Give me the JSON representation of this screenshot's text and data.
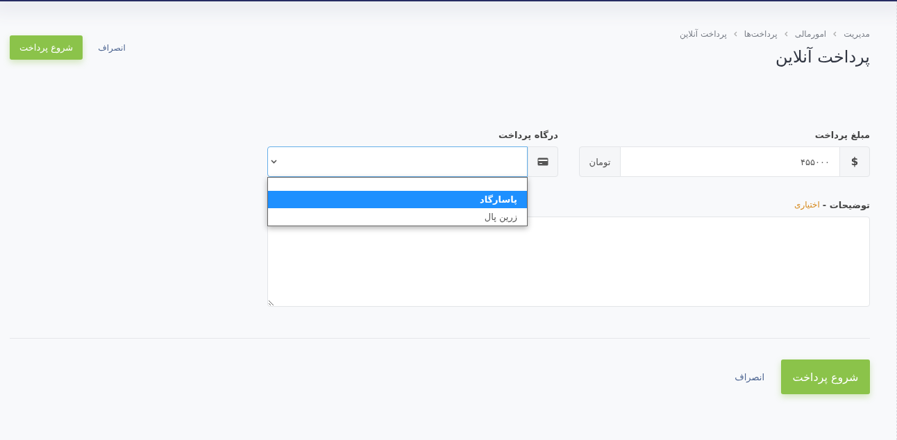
{
  "breadcrumb": [
    {
      "label": "مدیریت"
    },
    {
      "label": "امورمالی"
    },
    {
      "label": "پرداخت‌ها"
    },
    {
      "label": "پرداخت آنلاین"
    }
  ],
  "title": "پرداخت آنلاین",
  "header_actions": {
    "cancel": "انصراف",
    "submit": "شروع پرداخت"
  },
  "amount": {
    "label": "مبلغ پرداخت",
    "prefix": "$",
    "value": "۴۵۵۰۰۰",
    "suffix": "تومان"
  },
  "gateway": {
    "label": "درگاه پرداخت",
    "expanded": true,
    "options": [
      {
        "label": "پاسارگاد",
        "selected": true
      },
      {
        "label": "زرین پال",
        "selected": false
      }
    ]
  },
  "description": {
    "label": "توضیحات -",
    "hint": "اختیاری"
  },
  "footer_actions": {
    "cancel": "انصراف",
    "submit": "شروع پرداخت"
  }
}
